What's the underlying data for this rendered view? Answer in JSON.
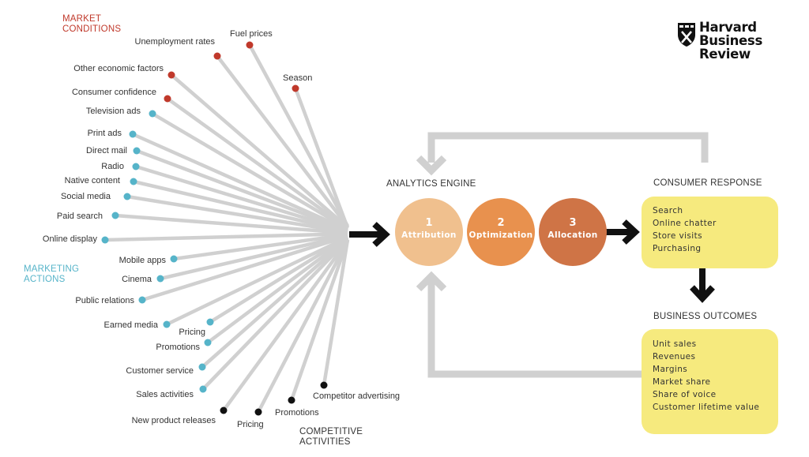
{
  "logo": {
    "lines": [
      "Harvard",
      "Business",
      "Review"
    ],
    "icon": "shield-icon"
  },
  "colors": {
    "market": "#c0392b",
    "marketing": "#56b4c9",
    "competitive": "#111111",
    "spoke": "#d0d0d0",
    "circle1": "#f0c08e",
    "circle2": "#e8914e",
    "circle3": "#cf7446",
    "box": "#f6ea7e"
  },
  "categories": {
    "market": [
      "MARKET",
      "CONDITIONS"
    ],
    "marketing": [
      "MARKETING",
      "ACTIONS"
    ],
    "competitive": [
      "COMPETITIVE",
      "ACTIVITIES"
    ]
  },
  "inputs": [
    {
      "label": "Unemployment rates",
      "group": "market"
    },
    {
      "label": "Fuel prices",
      "group": "market"
    },
    {
      "label": "Other economic factors",
      "group": "market"
    },
    {
      "label": "Season",
      "group": "market"
    },
    {
      "label": "Consumer confidence",
      "group": "market"
    },
    {
      "label": "Television ads",
      "group": "marketing"
    },
    {
      "label": "Print ads",
      "group": "marketing"
    },
    {
      "label": "Direct mail",
      "group": "marketing"
    },
    {
      "label": "Radio",
      "group": "marketing"
    },
    {
      "label": "Native content",
      "group": "marketing"
    },
    {
      "label": "Social media",
      "group": "marketing"
    },
    {
      "label": "Paid search",
      "group": "marketing"
    },
    {
      "label": "Online display",
      "group": "marketing"
    },
    {
      "label": "Mobile apps",
      "group": "marketing"
    },
    {
      "label": "Cinema",
      "group": "marketing"
    },
    {
      "label": "Public relations",
      "group": "marketing"
    },
    {
      "label": "Earned media",
      "group": "marketing"
    },
    {
      "label": "Pricing",
      "group": "marketing"
    },
    {
      "label": "Promotions",
      "group": "marketing"
    },
    {
      "label": "Customer service",
      "group": "marketing"
    },
    {
      "label": "Sales activities",
      "group": "marketing"
    },
    {
      "label": "New product releases",
      "group": "competitive"
    },
    {
      "label": "Pricing",
      "group": "competitive"
    },
    {
      "label": "Promotions",
      "group": "competitive"
    },
    {
      "label": "Competitor advertising",
      "group": "competitive"
    }
  ],
  "engine": {
    "title": "ANALYTICS ENGINE",
    "steps": [
      {
        "num": "1",
        "name": "Attribution"
      },
      {
        "num": "2",
        "name": "Optimization"
      },
      {
        "num": "3",
        "name": "Allocation"
      }
    ]
  },
  "consumer": {
    "title": "CONSUMER RESPONSE",
    "items": [
      "Search",
      "Online chatter",
      "Store visits",
      "Purchasing"
    ]
  },
  "business": {
    "title": "BUSINESS OUTCOMES",
    "items": [
      "Unit sales",
      "Revenues",
      "Margins",
      "Market share",
      "Share of voice",
      "Customer lifetime value"
    ]
  }
}
